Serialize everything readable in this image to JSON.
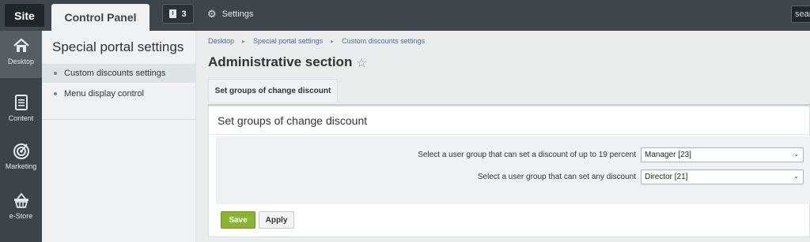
{
  "topbar": {
    "site_tab": "Site",
    "control_panel_tab": "Control Panel",
    "notifications_count": "3",
    "settings_label": "Settings",
    "search_value": "search"
  },
  "leftnav": {
    "items": [
      {
        "label": "Desktop",
        "icon": "home-icon"
      },
      {
        "label": "Content",
        "icon": "document-icon"
      },
      {
        "label": "Marketing",
        "icon": "target-icon"
      },
      {
        "label": "e-Store",
        "icon": "basket-icon"
      }
    ]
  },
  "submenu": {
    "title": "Special portal settings",
    "items": [
      {
        "label": "Custom discounts settings",
        "active": true
      },
      {
        "label": "Menu display control",
        "active": false
      }
    ]
  },
  "breadcrumb": [
    "Desktop",
    "Special portal settings",
    "Custom discounts settings"
  ],
  "page_title": "Administrative section",
  "tab_label": "Set groups of change discount",
  "panel": {
    "title": "Set groups of change discount",
    "fields": [
      {
        "label": "Select a user group that can set a discount of up to 19 percent",
        "value": "Manager [23]"
      },
      {
        "label": "Select a user group that can set any discount",
        "value": "Director [21]"
      }
    ]
  },
  "buttons": {
    "save": "Save",
    "apply": "Apply"
  },
  "colors": {
    "topbar": "#3d464c",
    "save_button": "#89b42b",
    "link": "#4a6d9a"
  }
}
